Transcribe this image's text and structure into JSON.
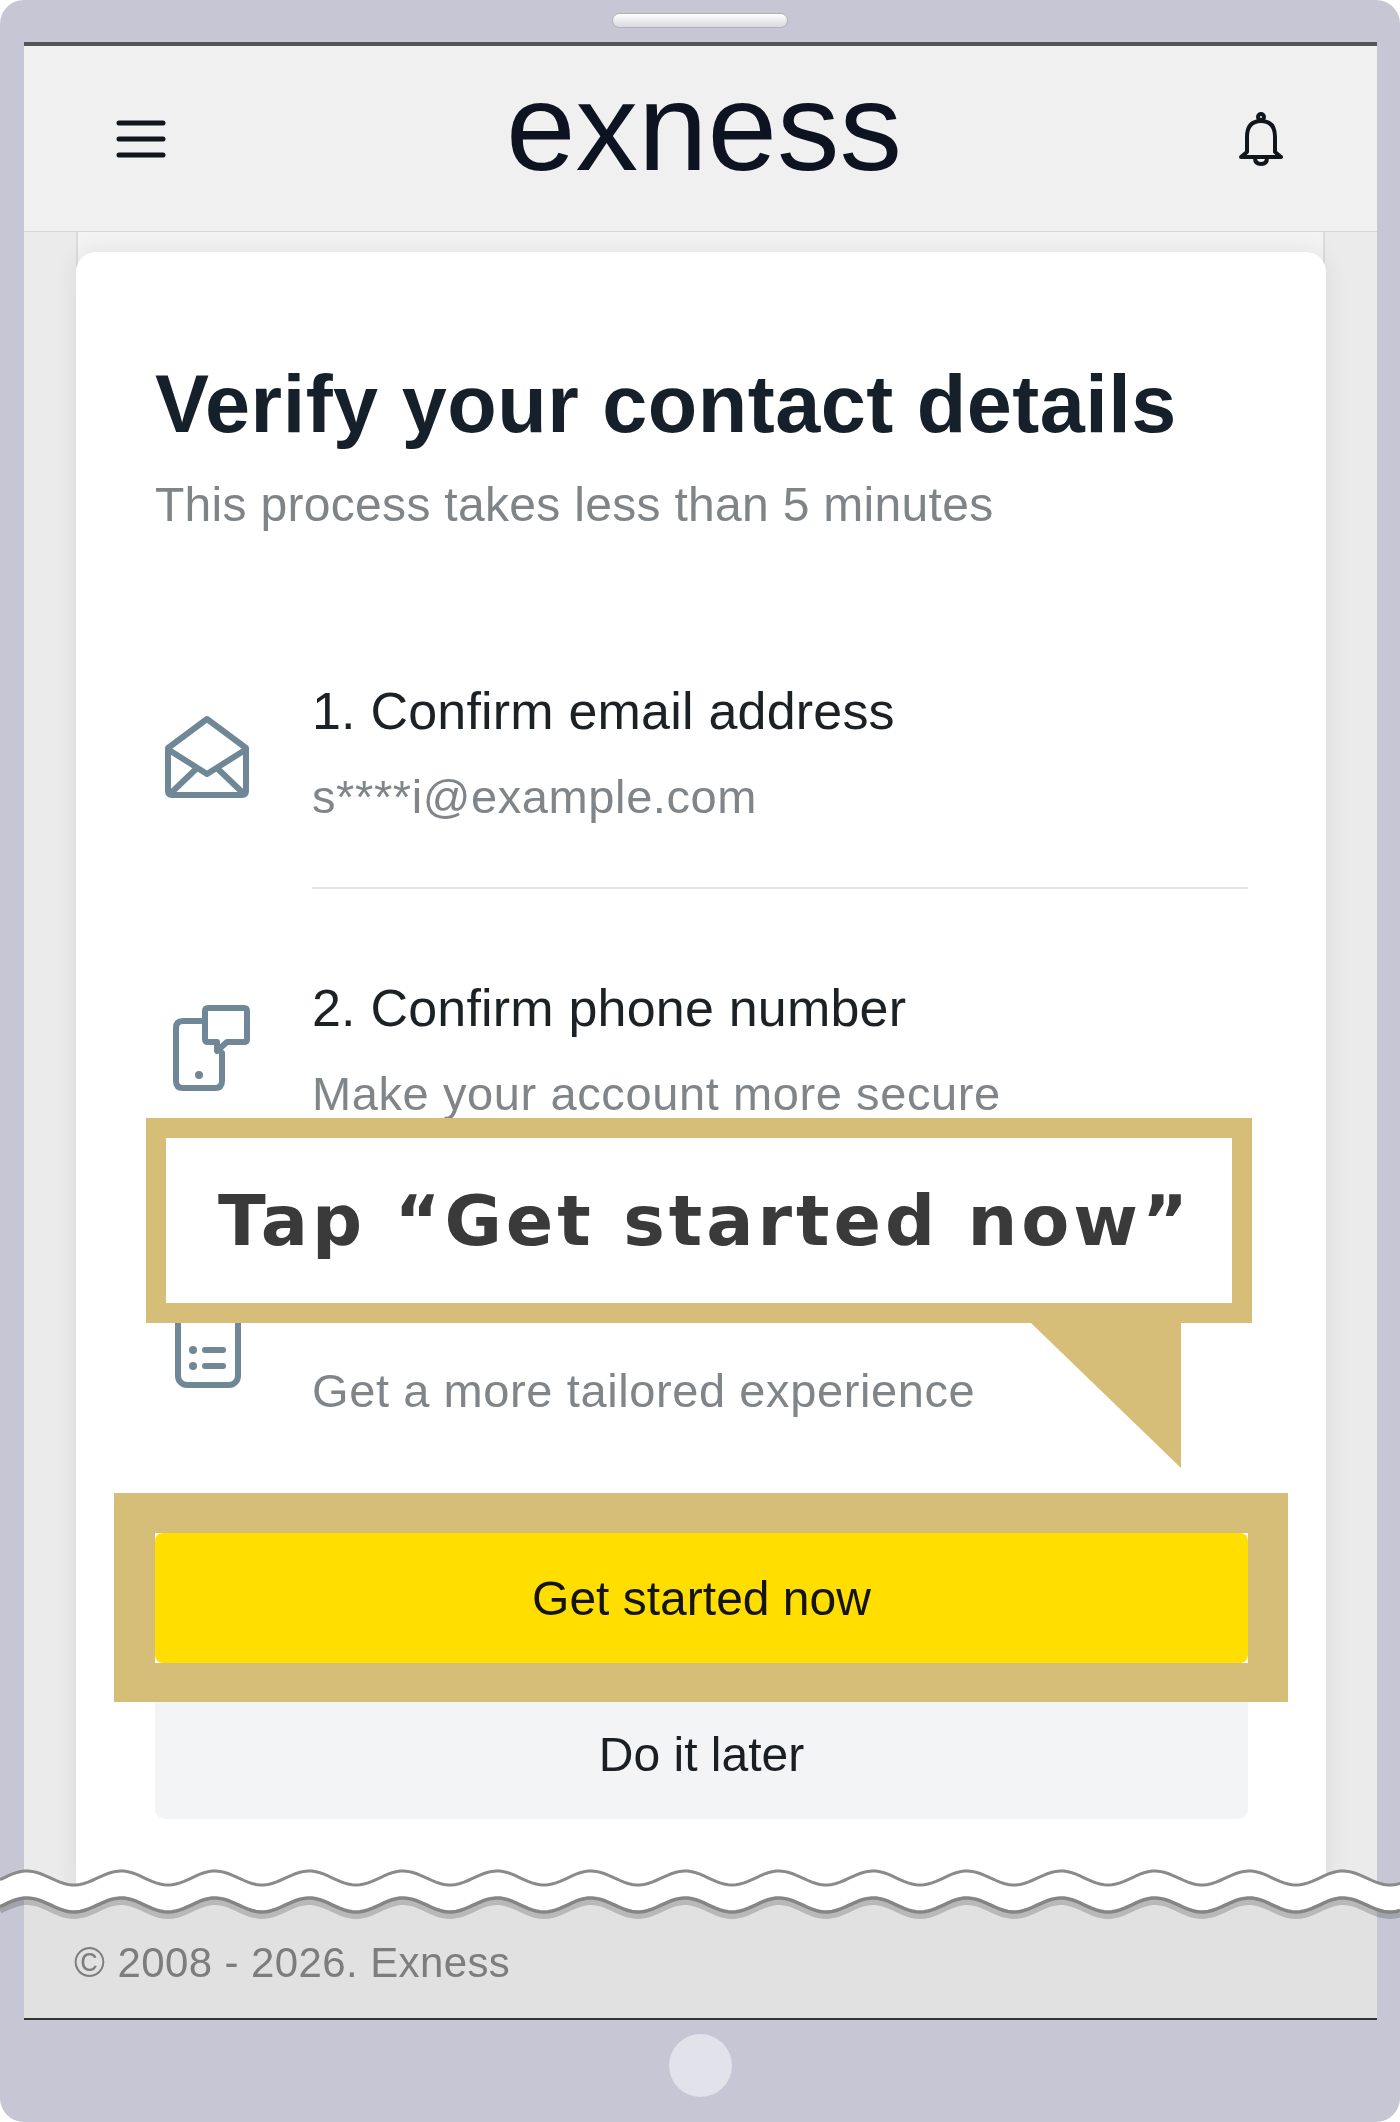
{
  "header": {
    "logo": "exness"
  },
  "dialog": {
    "title": "Verify your contact details",
    "subtitle": "This process takes less than 5 minutes",
    "steps": [
      {
        "kind": "email",
        "title": "1. Confirm email address",
        "detail": "s****i@example.com"
      },
      {
        "kind": "phone",
        "title": "2. Confirm phone number",
        "detail": "Make your account more secure"
      },
      {
        "kind": "details",
        "detail": "Get a more tailored experience"
      }
    ],
    "buttons": [
      {
        "kind": "primary",
        "label": "Get started now",
        "highlighted": true
      },
      {
        "kind": "secondary",
        "label": "Do it later",
        "highlighted": false
      }
    ]
  },
  "callout": {
    "text": "Tap “Get started now”"
  },
  "footer": {
    "copyright": "© 2008 - 2026. Exness"
  }
}
